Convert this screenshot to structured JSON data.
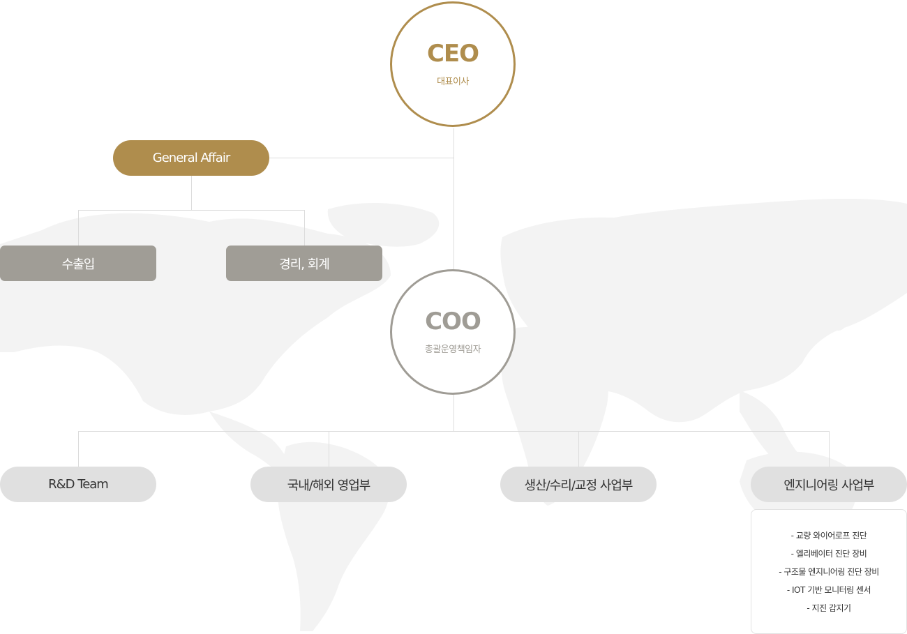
{
  "ceo": {
    "title": "CEO",
    "subtitle": "대표이사"
  },
  "general_affair": {
    "label": "General Affair"
  },
  "ga_departments": [
    {
      "label": "수출입"
    },
    {
      "label": "경리, 회계"
    }
  ],
  "coo": {
    "title": "COO",
    "subtitle": "총괄운영책임자"
  },
  "divisions": [
    {
      "label": "R&D Team"
    },
    {
      "label": "국내/해외 영업부"
    },
    {
      "label": "생산/수리/교정 사업부"
    },
    {
      "label": "엔지니어링 사업부"
    }
  ],
  "engineering_details": [
    "- 교량 와이어로프 진단",
    "- 엘리베이터 진단 장비",
    "- 구조물 엔지니어링 진단 장비",
    "- IOT 기반 모니터링 센서",
    "- 지진 감지기"
  ],
  "colors": {
    "gold": "#af8d4d",
    "gray": "#a09d96",
    "light_gray": "#e0e0e0",
    "map": "#f2f2f2"
  }
}
